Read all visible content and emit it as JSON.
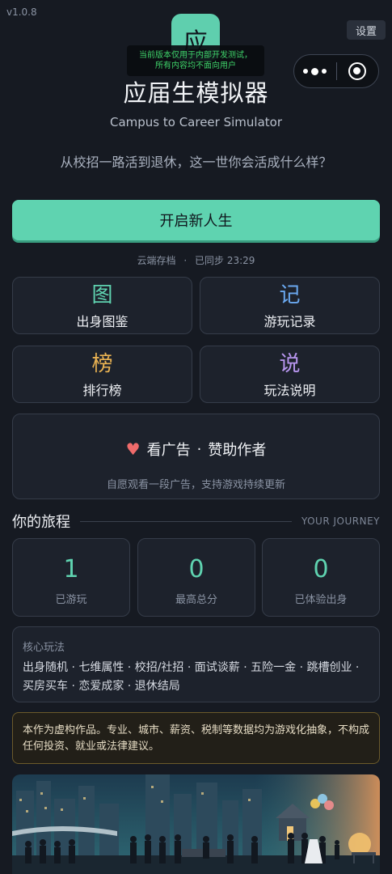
{
  "app": {
    "version": "v1.0.8",
    "settings_label": "设置",
    "logo_char": "应",
    "dev_notice_line1": "当前版本仅用于内部开发测试，",
    "dev_notice_line2": "所有内容均不面向用户",
    "title": "应届生模拟器",
    "subtitle_en": "Campus to Career Simulator",
    "tagline": "从校招一路活到退休，这一世你会活成什么样？"
  },
  "start": {
    "label": "开启新人生"
  },
  "sync": {
    "label": "云端存档",
    "sep": "·",
    "status": "已同步 23:29"
  },
  "menu": [
    {
      "glyph": "图",
      "label": "出身图鉴",
      "color": "#5fd3b0"
    },
    {
      "glyph": "记",
      "label": "游玩记录",
      "color": "#6aa8ef"
    },
    {
      "glyph": "榜",
      "label": "排行榜",
      "color": "#e9b252"
    },
    {
      "glyph": "说",
      "label": "玩法说明",
      "color": "#b795ee"
    }
  ],
  "ad": {
    "label_a": "看广告",
    "sep": "·",
    "label_b": "赞助作者",
    "sub": "自愿观看一段广告，支持游戏持续更新"
  },
  "journey": {
    "heading": "你的旅程",
    "heading_en": "YOUR JOURNEY",
    "stats": [
      {
        "value": "1",
        "label": "已游玩"
      },
      {
        "value": "0",
        "label": "最高总分"
      },
      {
        "value": "0",
        "label": "已体验出身"
      }
    ]
  },
  "core": {
    "title": "核心玩法",
    "text": "出身随机 · 七维属性 · 校招/社招 · 面试谈薪 · 五险一金 · 跳槽创业 · 买房买车 · 恋爱成家 · 退休结局"
  },
  "disclaimer": "本作为虚构作品。专业、城市、薪资、税制等数据均为游戏化抽象，不构成任何投资、就业或法律建议。",
  "colors": {
    "accent": "#5fd3b0",
    "background": "#161a22",
    "card": "#1d222c"
  }
}
